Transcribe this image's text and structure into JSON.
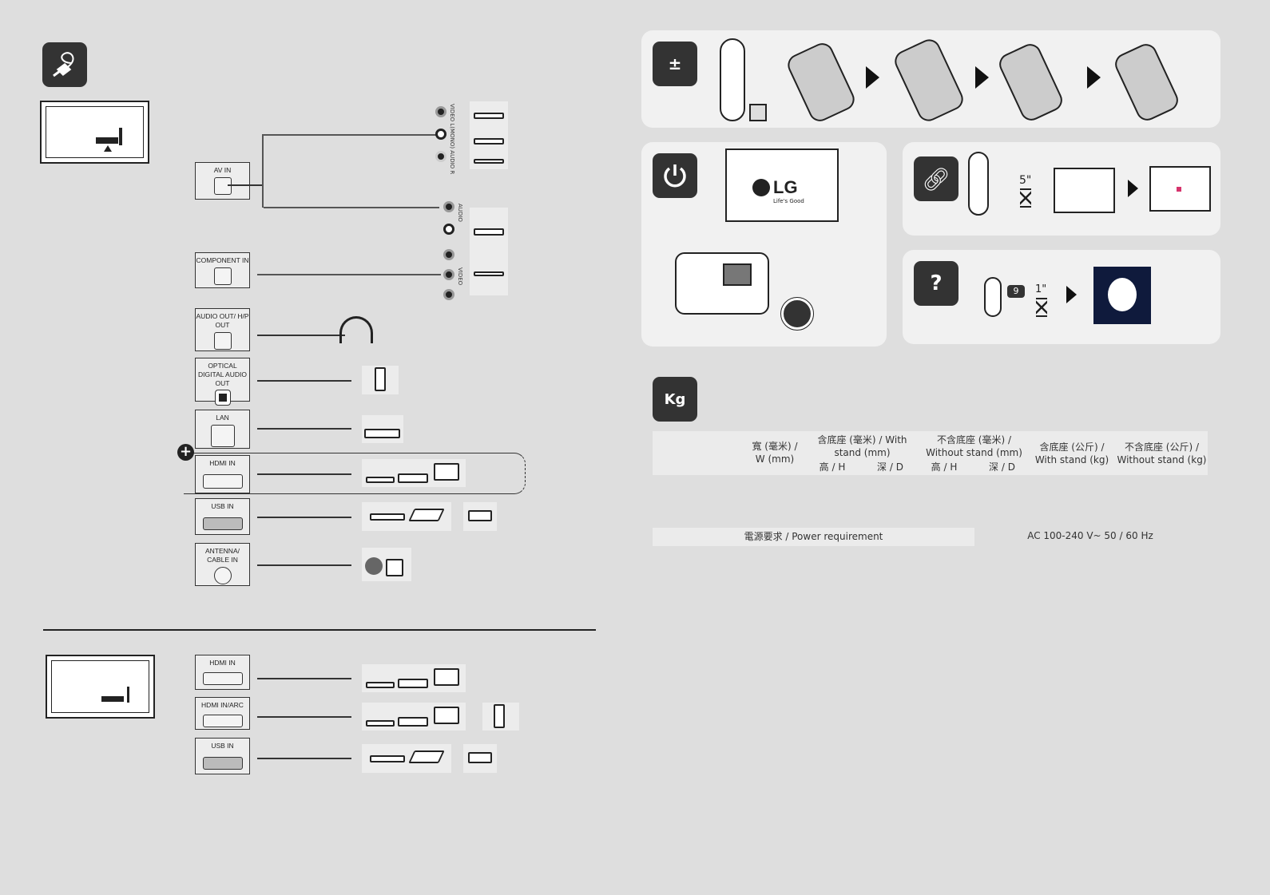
{
  "icons": {
    "connection": "cable-plug-icon",
    "battery": "battery-plus-minus-icon",
    "power": "power-icon",
    "pairing": "link-icon",
    "help": "question-chat-icon",
    "weight": "weight-kg-icon",
    "add": "plus-circle-icon"
  },
  "ports_side": [
    {
      "label": "AV IN"
    },
    {
      "label": "COMPONENT IN"
    },
    {
      "label": "AUDIO OUT/ H/P OUT"
    },
    {
      "label": "OPTICAL DIGITAL AUDIO OUT"
    },
    {
      "label": "LAN"
    },
    {
      "label": "HDMI IN"
    },
    {
      "label": "USB IN"
    },
    {
      "label": "ANTENNA/ CABLE IN"
    }
  ],
  "ports_rear": [
    {
      "label": "HDMI IN"
    },
    {
      "label": "HDMI IN/ARC"
    },
    {
      "label": "USB IN"
    }
  ],
  "jack_labels": {
    "av": "VIDEO L(MONO) AUDIO R",
    "audio": "AUDIO",
    "video": "VIDEO"
  },
  "tv_screen": {
    "brand": "LG",
    "slogan": "Life's Good"
  },
  "pairing": {
    "hold_time": "5\""
  },
  "help": {
    "hold_time": "1\"",
    "key": "9"
  },
  "specs": {
    "headers": {
      "width": "寬 (毫米) / W (mm)",
      "with_stand_mm": "含底座 (毫米) / With stand (mm)",
      "without_stand_mm": "不含底座 (毫米) / Without stand (mm)",
      "height": "高 / H",
      "depth": "深 / D",
      "with_stand_kg": "含底座 (公斤) / With stand (kg)",
      "without_stand_kg": "不含底座 (公斤) / Without stand (kg)"
    },
    "power_label": "電源要求 / Power requirement",
    "power_value": "AC 100-240 V~ 50 / 60 Hz"
  }
}
